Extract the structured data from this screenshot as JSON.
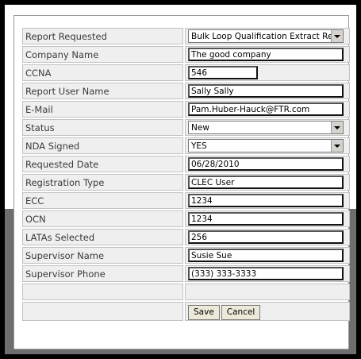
{
  "rows": [
    {
      "label": "Report Requested",
      "value": "Bulk Loop Qualification Extract Report"
    },
    {
      "label": "Company Name",
      "value": "The good company"
    },
    {
      "label": "CCNA",
      "value": "546"
    },
    {
      "label": "Report User Name",
      "value": "Sally Sally"
    },
    {
      "label": "E-Mail",
      "value": "Pam.Huber-Hauck@FTR.com"
    },
    {
      "label": "Status",
      "value": "New"
    },
    {
      "label": "NDA Signed",
      "value": "YES"
    },
    {
      "label": "Requested Date",
      "value": "06/28/2010"
    },
    {
      "label": "Registration Type",
      "value": "CLEC User"
    },
    {
      "label": "ECC",
      "value": "1234"
    },
    {
      "label": "OCN",
      "value": "1234"
    },
    {
      "label": "LATAs Selected",
      "value": "256"
    },
    {
      "label": "Supervisor Name",
      "value": "Susie Sue"
    },
    {
      "label": "Supervisor Phone",
      "value": "(333) 333-3333"
    }
  ],
  "buttons": {
    "save": "Save",
    "cancel": "Cancel"
  }
}
